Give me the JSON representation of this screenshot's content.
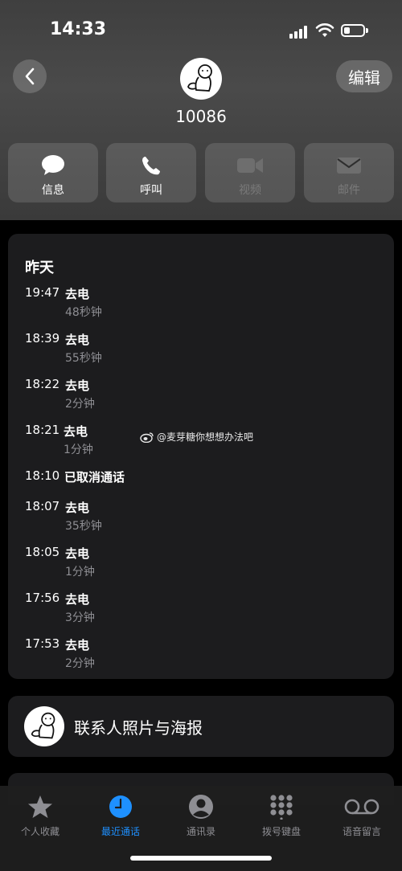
{
  "status": {
    "time": "14:33"
  },
  "header": {
    "back_icon": "chevron-left-icon",
    "edit_label": "编辑",
    "contact_name": "10086"
  },
  "actions": [
    {
      "label": "信息",
      "icon": "message-bubble-icon",
      "enabled": true
    },
    {
      "label": "呼叫",
      "icon": "phone-icon",
      "enabled": true
    },
    {
      "label": "视频",
      "icon": "video-camera-icon",
      "enabled": false
    },
    {
      "label": "邮件",
      "icon": "envelope-icon",
      "enabled": false
    }
  ],
  "log": {
    "day": "昨天",
    "calls": [
      {
        "time": "19:47",
        "type": "去电",
        "duration": "48秒钟"
      },
      {
        "time": "18:39",
        "type": "去电",
        "duration": "55秒钟"
      },
      {
        "time": "18:22",
        "type": "去电",
        "duration": "2分钟"
      },
      {
        "time": "18:21",
        "type": "去电",
        "duration": "1分钟"
      },
      {
        "time": "18:10",
        "type": "已取消通话",
        "duration": ""
      },
      {
        "time": "18:07",
        "type": "去电",
        "duration": "35秒钟"
      },
      {
        "time": "18:05",
        "type": "去电",
        "duration": "1分钟"
      },
      {
        "time": "17:56",
        "type": "去电",
        "duration": "3分钟"
      },
      {
        "time": "17:53",
        "type": "去电",
        "duration": "2分钟"
      }
    ]
  },
  "watermark": {
    "text": "@麦芽糖你想想办法吧"
  },
  "poster": {
    "label": "联系人照片与海报"
  },
  "tabbar": [
    {
      "label": "个人收藏",
      "icon": "star-icon",
      "active": false
    },
    {
      "label": "最近通话",
      "icon": "clock-icon",
      "active": true
    },
    {
      "label": "通讯录",
      "icon": "person-circle-icon",
      "active": false
    },
    {
      "label": "拨号键盘",
      "icon": "keypad-icon",
      "active": false
    },
    {
      "label": "语音留言",
      "icon": "voicemail-icon",
      "active": false
    }
  ],
  "colors": {
    "accent": "#1e90ff",
    "card": "#1c1c1e",
    "secondary_text": "#8e8e93"
  }
}
